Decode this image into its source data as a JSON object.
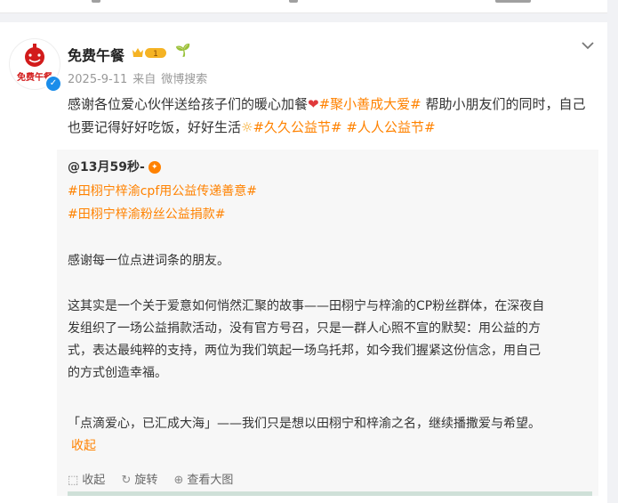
{
  "post": {
    "username": "免费午餐",
    "avatar_text": "免费午餐",
    "level_badge": "1",
    "verified_badge": "✓",
    "date": "2025-9-11",
    "source_prefix": "来自",
    "source": "微博搜索",
    "content": {
      "part1": "感谢各位爱心伙伴送给孩子们的暖心加餐",
      "topic1": "#聚小善成大爱#",
      "part2": " 帮助小朋友们的同时，自己也要记得好好吃饭，好好生活",
      "topic2": "#久久公益节#",
      "topic3": "#人人公益节#"
    }
  },
  "repost": {
    "author": "@13月59秒-",
    "medal": "✦",
    "topic1": "#田栩宁梓渝cpf用公益传递善意#",
    "topic2": "#田栩宁梓渝粉丝公益捐款#",
    "para1": "感谢每一位点进词条的朋友。",
    "para2_line1": "这其实是一个关于爱意如何悄然汇聚的故事——田栩宁与梓渝的CP粉丝群体，在深夜自",
    "para2_line2": "发组织了一场公益捐款活动，没有官方号召，只是一群人心照不宣的默契：用公益的方",
    "para2_line3": "式，表达最纯粹的支持，两位为我们筑起一场乌托邦，如今我们握紧这份信念，用自己",
    "para2_line4": "的方式创造幸福。",
    "para3": "「点滴爱心，已汇成大海」——我们只是想以田栩宁和梓渝之名，继续播撒爱与希望。",
    "collapse": "收起"
  },
  "actions": {
    "collapse": "收起",
    "rotate": "旋转",
    "view_large": "查看大图"
  },
  "icons": {
    "more": "chevron-down-icon",
    "heart": "heart-icon",
    "sun": "sun-icon"
  },
  "colors": {
    "topic": "#ff8200",
    "verified": "#1a8dea",
    "background": "#f1f2f5"
  }
}
